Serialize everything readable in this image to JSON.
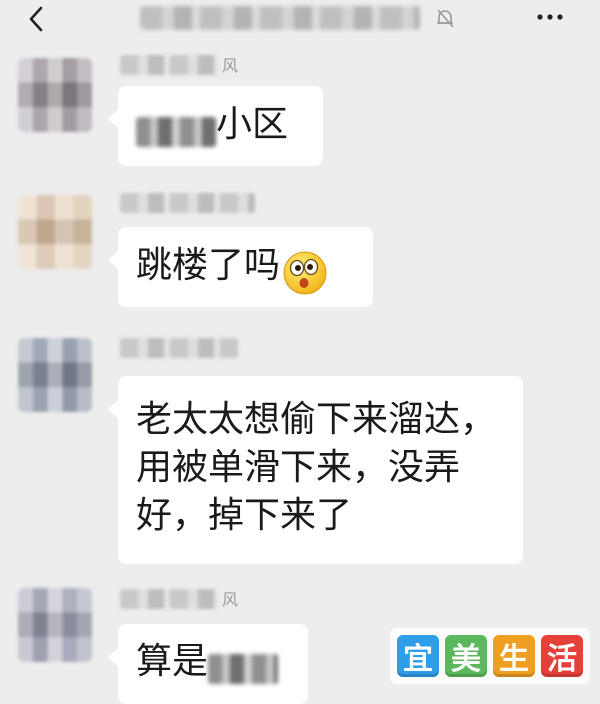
{
  "header": {
    "title": "",
    "back_icon": "chevron-left-icon",
    "mute_icon": "bell-muted-icon",
    "more_icon": "more-dots-icon"
  },
  "messages": [
    {
      "sender_suffix": "风",
      "text": "小区"
    },
    {
      "sender_suffix": "",
      "text": "跳楼了吗",
      "emoji": "surprised-face-icon"
    },
    {
      "sender_suffix": "",
      "text": "老太太想偷下来溜达，\n用被单滑下来，没弄\n好，掉下来了"
    },
    {
      "sender_suffix": "风",
      "text": "算是"
    }
  ],
  "watermark": {
    "chars": [
      "宜",
      "美",
      "生",
      "活"
    ],
    "colors": [
      "#2f9ee8",
      "#5cb85c",
      "#f0a020",
      "#e6403a"
    ]
  }
}
